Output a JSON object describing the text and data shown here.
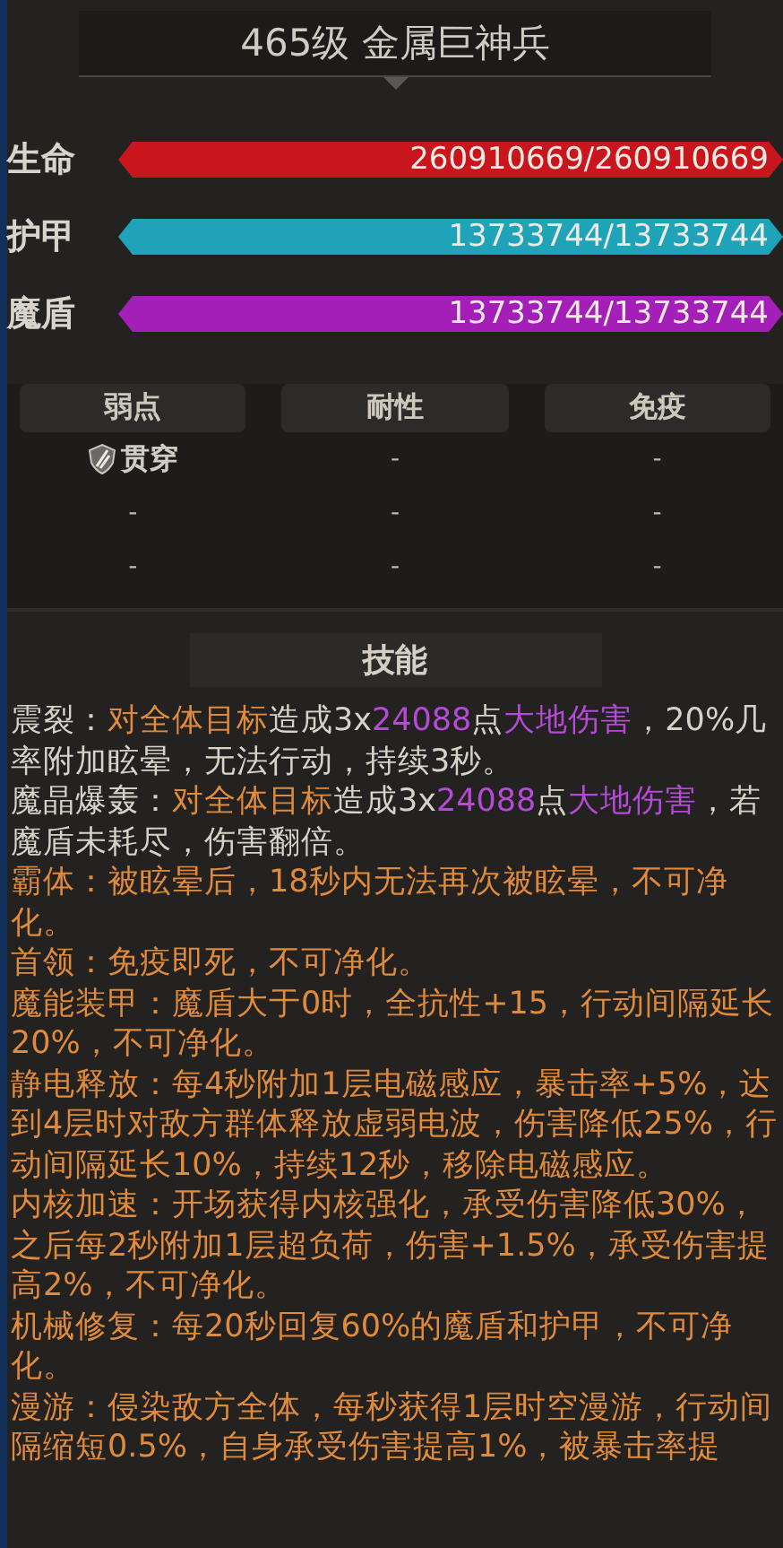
{
  "title": "465级  金属巨神兵",
  "bars": [
    {
      "label": "生命",
      "value": "260910669/260910669",
      "level": 1,
      "color": "#c8161c"
    },
    {
      "label": "护甲",
      "value": "13733744/13733744",
      "level": 1,
      "color": "#1fa3b8"
    },
    {
      "label": "魔盾",
      "value": "13733744/13733744",
      "level": 1,
      "color": "#a41fb8"
    }
  ],
  "resist": {
    "columns": [
      {
        "header": "弱点",
        "cells": [
          {
            "kind": "damage-type",
            "text": "贯穿"
          },
          {
            "kind": "empty",
            "text": "-"
          },
          {
            "kind": "empty",
            "text": "-"
          }
        ]
      },
      {
        "header": "耐性",
        "cells": [
          {
            "kind": "empty",
            "text": "-"
          },
          {
            "kind": "empty",
            "text": "-"
          },
          {
            "kind": "empty",
            "text": "-"
          }
        ]
      },
      {
        "header": "免疫",
        "cells": [
          {
            "kind": "empty",
            "text": "-"
          },
          {
            "kind": "empty",
            "text": "-"
          },
          {
            "kind": "empty",
            "text": "-"
          }
        ]
      }
    ]
  },
  "skills_header": "技能",
  "skills": [
    {
      "segments": [
        {
          "kind": "plain",
          "text": "震裂："
        },
        {
          "kind": "target",
          "text": "对全体目标"
        },
        {
          "kind": "plain",
          "text": "造成3x"
        },
        {
          "kind": "value",
          "text": "24088"
        },
        {
          "kind": "plain",
          "text": "点"
        },
        {
          "kind": "value",
          "text": "大地伤害"
        },
        {
          "kind": "plain",
          "text": "，20%几率附加眩晕，无法行动，持续3秒。"
        }
      ]
    },
    {
      "segments": [
        {
          "kind": "plain",
          "text": "魔晶爆轰："
        },
        {
          "kind": "target",
          "text": "对全体目标"
        },
        {
          "kind": "plain",
          "text": "造成3x"
        },
        {
          "kind": "value",
          "text": "24088"
        },
        {
          "kind": "plain",
          "text": "点"
        },
        {
          "kind": "value",
          "text": "大地伤害"
        },
        {
          "kind": "plain",
          "text": "，若魔盾未耗尽，伤害翻倍。"
        }
      ]
    },
    {
      "segments": [
        {
          "kind": "target",
          "text": "霸体：被眩晕后，18秒内无法再次被眩晕，不可净化。"
        }
      ]
    },
    {
      "segments": [
        {
          "kind": "target",
          "text": "首领：免疫即死，不可净化。"
        }
      ]
    },
    {
      "segments": [
        {
          "kind": "target",
          "text": "魔能装甲：魔盾大于0时，全抗性+15，行动间隔延长20%，不可净化。"
        }
      ]
    },
    {
      "segments": [
        {
          "kind": "target",
          "text": "静电释放：每4秒附加1层电磁感应，暴击率+5%，达到4层时对敌方群体释放虚弱电波，伤害降低25%，行动间隔延长10%，持续12秒，移除电磁感应。"
        }
      ]
    },
    {
      "segments": [
        {
          "kind": "target",
          "text": "内核加速：开场获得内核强化，承受伤害降低30%，之后每2秒附加1层超负荷，伤害+1.5%，承受伤害提高2%，不可净化。"
        }
      ]
    },
    {
      "segments": [
        {
          "kind": "target",
          "text": "机械修复：每20秒回复60%的魔盾和护甲，不可净化。"
        }
      ]
    },
    {
      "segments": [
        {
          "kind": "target",
          "text": "漫游：侵染敌方全体，每秒获得1层时空漫游，行动间隔缩短0.5%，自身承受伤害提高1%，被暴击率提"
        }
      ]
    }
  ]
}
